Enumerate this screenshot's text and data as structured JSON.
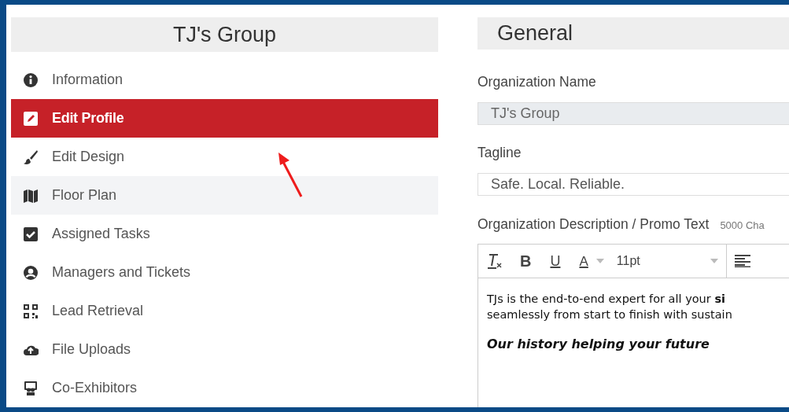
{
  "sidebar": {
    "title": "TJ's Group",
    "items": [
      {
        "label": "Information",
        "selected": false,
        "hovered": false
      },
      {
        "label": "Edit Profile",
        "selected": true,
        "hovered": false
      },
      {
        "label": "Edit Design",
        "selected": false,
        "hovered": false
      },
      {
        "label": "Floor Plan",
        "selected": false,
        "hovered": true
      },
      {
        "label": "Assigned Tasks",
        "selected": false,
        "hovered": false
      },
      {
        "label": "Managers and Tickets",
        "selected": false,
        "hovered": false
      },
      {
        "label": "Lead Retrieval",
        "selected": false,
        "hovered": false
      },
      {
        "label": "File Uploads",
        "selected": false,
        "hovered": false
      },
      {
        "label": "Co-Exhibitors",
        "selected": false,
        "hovered": false
      }
    ]
  },
  "panel": {
    "title": "General",
    "org_name": {
      "label": "Organization Name",
      "value": "TJ's Group",
      "disabled": true
    },
    "tagline": {
      "label": "Tagline",
      "value": "Safe. Local. Reliable."
    },
    "description": {
      "label": "Organization Description / Promo Text",
      "hint": "5000 Cha",
      "toolbar": {
        "bold": "B",
        "underline": "U",
        "text_letter": "A",
        "font_size": "11pt"
      },
      "paragraphs": [
        "TJs is the end-to-end expert for all your **si**\nseamlessly from start to finish with sustain"
      ],
      "heading": "Our history helping your future"
    }
  }
}
